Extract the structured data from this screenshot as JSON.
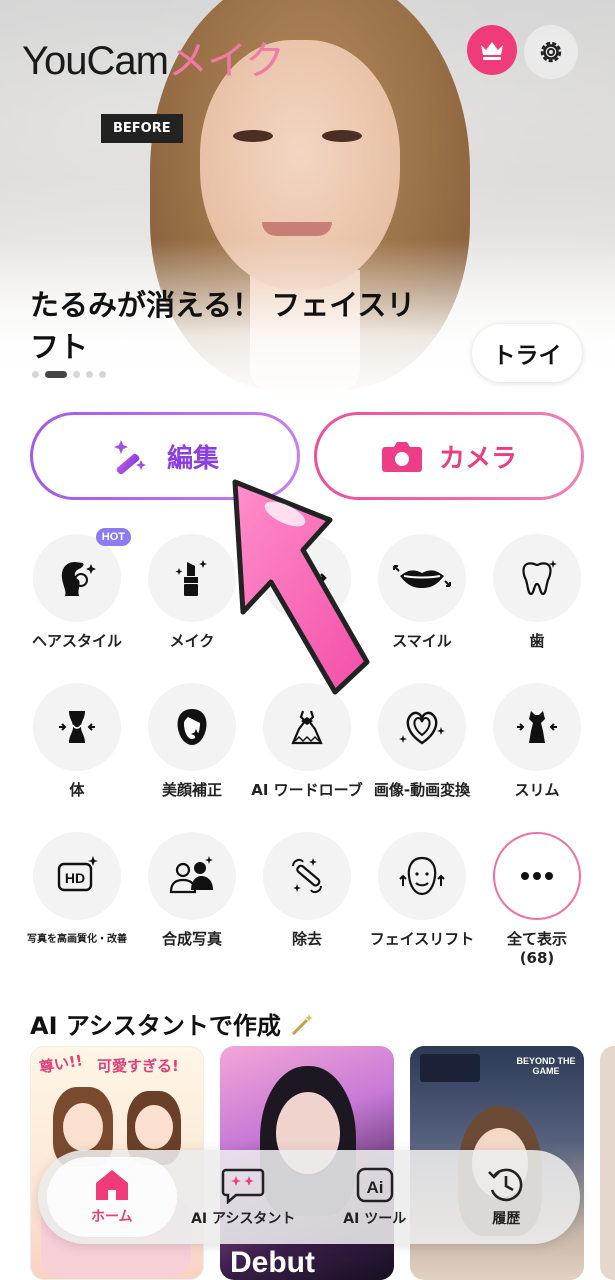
{
  "header": {
    "logo_latin": "YouCam",
    "logo_kana": "メイク"
  },
  "hero": {
    "badge": "BEFORE",
    "title": "たるみが消える！ フェイスリフト",
    "try_label": "トライ",
    "slide_count": 5,
    "active_slide": 2
  },
  "actions": {
    "edit_label": "編集",
    "camera_label": "カメラ"
  },
  "features": [
    {
      "label": "ヘアスタイル",
      "icon": "hair-icon",
      "badge": "HOT"
    },
    {
      "label": "メイク",
      "icon": "lipstick-icon"
    },
    {
      "label": "",
      "icon": "face-reshape-icon"
    },
    {
      "label": "スマイル",
      "icon": "smile-icon"
    },
    {
      "label": "歯",
      "icon": "tooth-icon"
    },
    {
      "label": "体",
      "icon": "body-icon"
    },
    {
      "label": "美顔補正",
      "icon": "beauty-face-icon"
    },
    {
      "label": "AI ワードローブ",
      "icon": "wardrobe-icon"
    },
    {
      "label": "画像-動画変換",
      "icon": "image-to-video-icon"
    },
    {
      "label": "スリム",
      "icon": "slim-icon"
    },
    {
      "label": "写真を高画質化・改善",
      "icon": "hd-icon"
    },
    {
      "label": "合成写真",
      "icon": "group-photo-icon"
    },
    {
      "label": "除去",
      "icon": "remove-icon"
    },
    {
      "label": "フェイスリフト",
      "icon": "face-lift-icon"
    },
    {
      "label": "全て表示\n(68)",
      "icon": "more-icon"
    }
  ],
  "ai_section": {
    "title": "AI アシスタントで作成",
    "cards": [
      {
        "caption": "可愛すぎる!"
      },
      {
        "caption": "Debut"
      },
      {
        "caption": "BEYOND THE GAME"
      }
    ]
  },
  "nav": {
    "items": [
      {
        "label": "ホーム",
        "icon": "home-icon",
        "active": true
      },
      {
        "label": "AI アシスタント",
        "icon": "ai-assistant-icon",
        "active": false
      },
      {
        "label": "AI ツール",
        "icon": "ai-tools-icon",
        "active": false
      },
      {
        "label": "履歴",
        "icon": "history-icon",
        "active": false
      }
    ]
  },
  "colors": {
    "brand_pink": "#ef3b79",
    "edit_purple": "#8c3fe0",
    "camera_pink": "#ea3d84"
  }
}
